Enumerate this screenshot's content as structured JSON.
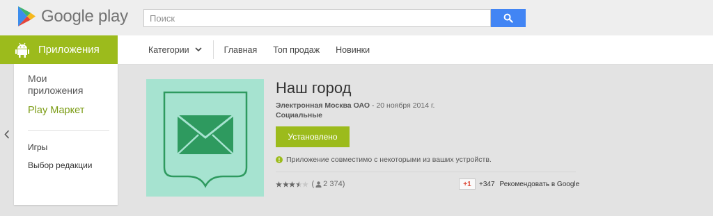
{
  "header": {
    "logo_text": "Google play",
    "search": {
      "placeholder": "Поиск",
      "value": ""
    },
    "search_button_icon": "search-icon"
  },
  "nav": {
    "apps_tab": "Приложения",
    "categories": "Категории",
    "home": "Главная",
    "top_charts": "Топ продаж",
    "new_releases": "Новинки"
  },
  "sidebar": {
    "my_apps": "Мои приложения",
    "store": "Play Маркет",
    "games": "Игры",
    "editors_choice": "Выбор редакции"
  },
  "app": {
    "title": "Наш город",
    "developer": "Электронная Москва ОАО",
    "date_sep": " - ",
    "date": "20 ноября 2014 г.",
    "category": "Социальные",
    "install_label": "Установлено",
    "compat_text": "Приложение совместимо с некоторыми из ваших устройств.",
    "rating_stars": 3.5,
    "rating_open": "(",
    "rating_count": "2 374",
    "rating_close": ")",
    "gplus_label": "+1",
    "gplus_count": "+347",
    "recommend_text": "Рекомендовать в Google"
  },
  "colors": {
    "accent_green": "#9cbb1c",
    "search_blue": "#4285f4",
    "icon_bg": "#a6e3d0",
    "icon_green": "#2e9a5f"
  }
}
